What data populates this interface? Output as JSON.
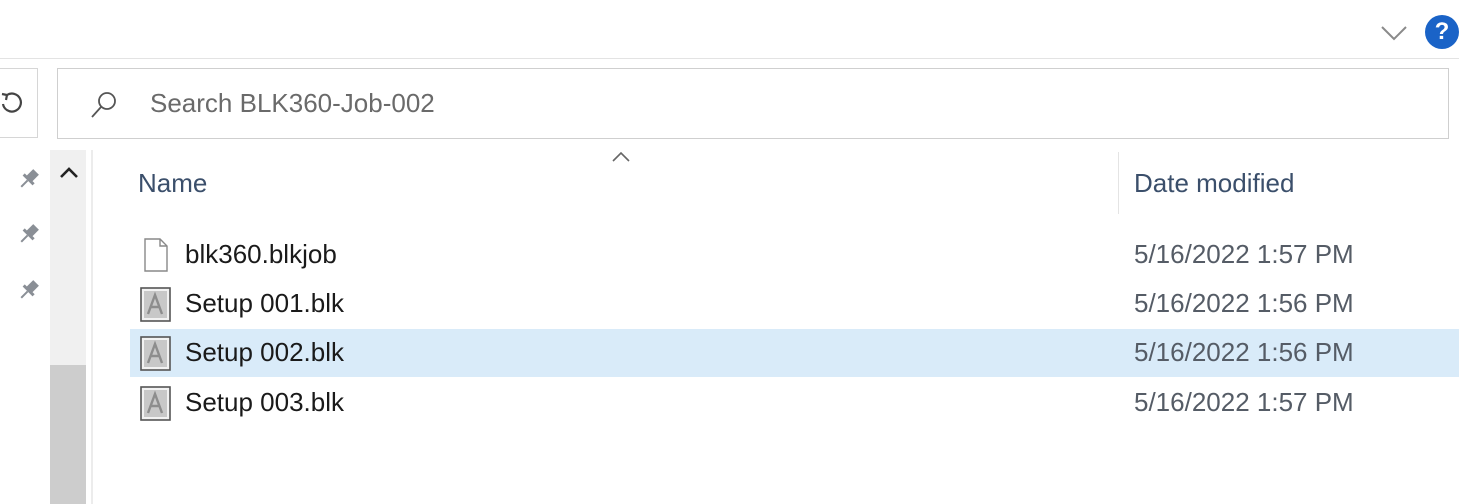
{
  "ribbon": {
    "expand_icon": "chevron-down-icon",
    "help_label": "?",
    "help_color": "#1a63c7"
  },
  "toolbar": {
    "refresh_icon": "refresh-icon"
  },
  "search": {
    "placeholder": "Search BLK360-Job-002",
    "value": ""
  },
  "navigation": {
    "pinned_icons": [
      "pin-icon",
      "pin-icon",
      "pin-icon"
    ],
    "scroll_up_icon": "chevron-up-icon"
  },
  "columns": {
    "name": "Name",
    "date_modified": "Date modified",
    "sort_indicator_icon": "chevron-up-icon"
  },
  "files": [
    {
      "name": "blk360.blkjob",
      "date": "5/16/2022 1:57 PM",
      "icon": "blank-file-icon",
      "selected": false
    },
    {
      "name": "Setup 001.blk",
      "date": "5/16/2022 1:56 PM",
      "icon": "blk-file-icon",
      "selected": false
    },
    {
      "name": "Setup 002.blk",
      "date": "5/16/2022 1:56 PM",
      "icon": "blk-file-icon",
      "selected": true
    },
    {
      "name": "Setup 003.blk",
      "date": "5/16/2022 1:57 PM",
      "icon": "blk-file-icon",
      "selected": false
    }
  ],
  "colors": {
    "selection": "#d9ebf9",
    "header_text": "#3b4f6b"
  }
}
